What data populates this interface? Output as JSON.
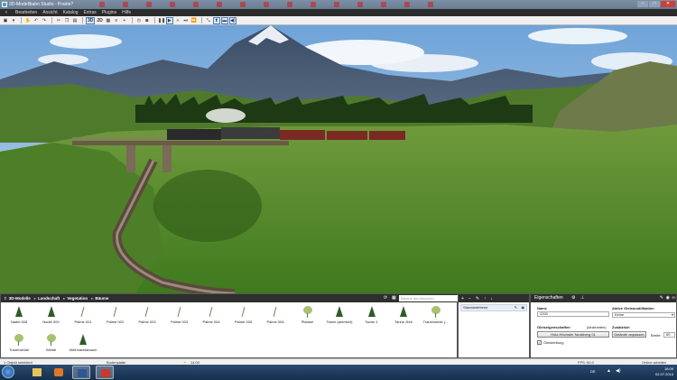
{
  "window": {
    "title": "3D-Modellbahn Studio - Prairie?",
    "buttons": [
      "–",
      "□",
      "✕"
    ]
  },
  "menu": {
    "items": [
      "Bearbeiten",
      "Ansicht",
      "Katalog",
      "Extras",
      "Plugins",
      "Hilfe"
    ]
  },
  "toolbar": {
    "view2d_label": "2D",
    "view3d_label": "3D"
  },
  "library": {
    "breadcrumb": [
      "3D-Modelle",
      "Landschaft",
      "Vegetation",
      "Bäume"
    ],
    "search_placeholder": "Bäume durchsuchen",
    "items": [
      {
        "label": "Nadel 008"
      },
      {
        "label": "Nadel 009"
      },
      {
        "label": "Palme 001"
      },
      {
        "label": "Palme 002"
      },
      {
        "label": "Palme 003"
      },
      {
        "label": "Palme 003"
      },
      {
        "label": "Palme 004"
      },
      {
        "label": "Palme 005"
      },
      {
        "label": "Palme 006"
      },
      {
        "label": "Platane"
      },
      {
        "label": "Tanne (animiert)"
      },
      {
        "label": "Tanne 1"
      },
      {
        "label": "Tanne 2bm"
      },
      {
        "label": "Trauerweide (..."
      },
      {
        "label": "Trauerweide"
      },
      {
        "label": "Weide"
      },
      {
        "label": "Weihnachtsbaum"
      }
    ]
  },
  "layers": {
    "items": [
      {
        "label": "Standardebene"
      }
    ]
  },
  "properties": {
    "title": "Eigenschaften",
    "name_label": "Name",
    "name_value": "2200",
    "active_mod_label": "Aktive Gleismodifikation",
    "active_mod_value": "Keine",
    "track_props_label": "Gleiseigenschaften",
    "edit_link": "(bearbeiten)",
    "track_type_button": "Holz-Höchster Neubberg 01",
    "extra_label": "Zusätzlich",
    "adapt_terrain_button": "Gelände anpassen",
    "width_label": "Breite:",
    "width_value": "60",
    "track_bed_label": "Gleisbettung",
    "track_bed_checked": true
  },
  "statusbar": {
    "selection": "1 Objekt selektiert",
    "layer": "Bodenplatte",
    "time": "14:00",
    "fps": "FPS: 60,0",
    "online": "Online arbeiten"
  },
  "taskbar": {
    "lang": "DE",
    "clock_time": "18:09",
    "clock_date": "02.07.2016"
  }
}
